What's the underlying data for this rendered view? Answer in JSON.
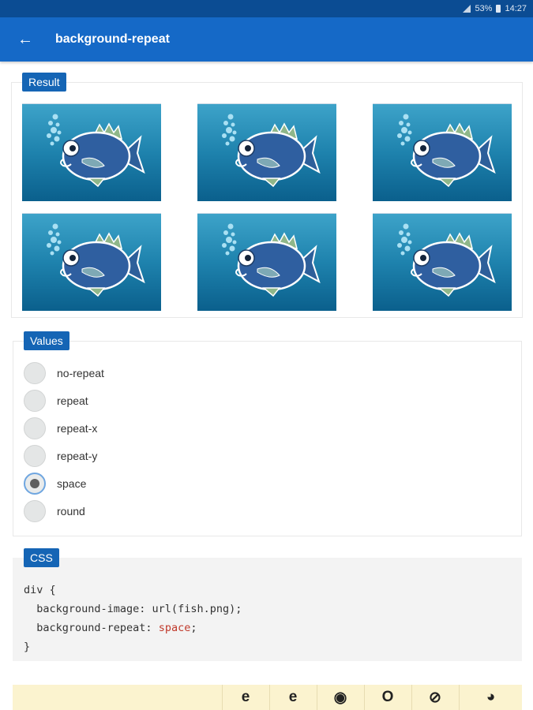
{
  "status": {
    "battery": "53%",
    "time": "14:27"
  },
  "appbar": {
    "back_icon": "←",
    "title": "background-repeat"
  },
  "result": {
    "label": "Result"
  },
  "values": {
    "label": "Values",
    "options": [
      "no-repeat",
      "repeat",
      "repeat-x",
      "repeat-y",
      "space",
      "round"
    ],
    "selected": "space"
  },
  "css": {
    "label": "CSS",
    "line1": "div {",
    "line2_prefix": "  background-image: url(fish.png);",
    "line3_prefix": "  background-repeat: ",
    "line3_value": "space",
    "line3_suffix": ";",
    "line4": "}"
  },
  "browsers": {
    "icons": [
      "ie-icon",
      "edge-icon",
      "chrome-icon",
      "opera-icon",
      "safari-icon",
      "firefox-icon"
    ],
    "glyphs": [
      "e",
      "e",
      "◉",
      "O",
      "⊘",
      "◕"
    ]
  },
  "colors": {
    "status_bar": "#0b4c93",
    "app_bar": "#1569c7",
    "label_bg": "#1565b5",
    "code_value": "#c0392b",
    "browser_bar": "#fbf3cf"
  }
}
